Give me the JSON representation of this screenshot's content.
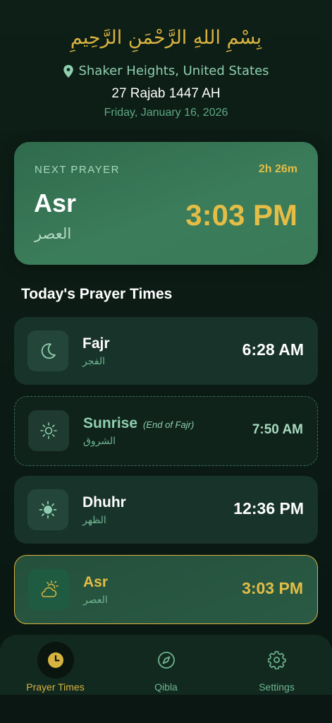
{
  "header": {
    "bismillah": "بِسْمِ اللهِ الرَّحْمَنِ الرَّحِيمِ",
    "location": "Shaker Heights, United States",
    "hijri_date": "27 Rajab 1447 AH",
    "gregorian_date": "Friday, January 16, 2026"
  },
  "next_prayer": {
    "label": "NEXT PRAYER",
    "countdown": "2h 26m",
    "name": "Asr",
    "arabic": "العصر",
    "time": "3:03 PM"
  },
  "section_title": "Today's Prayer Times",
  "prayers": [
    {
      "name": "Fajr",
      "arabic": "الفجر",
      "time": "6:28 AM",
      "icon": "moon-icon"
    },
    {
      "name": "Sunrise",
      "note": "(End of Fajr)",
      "arabic": "الشروق",
      "time": "7:50 AM",
      "icon": "sun-outline-icon"
    },
    {
      "name": "Dhuhr",
      "arabic": "الظهر",
      "time": "12:36 PM",
      "icon": "sun-icon"
    },
    {
      "name": "Asr",
      "arabic": "العصر",
      "time": "3:03 PM",
      "icon": "cloud-sun-icon"
    }
  ],
  "nav": {
    "items": [
      {
        "label": "Prayer Times",
        "icon": "clock-icon",
        "active": true
      },
      {
        "label": "Qibla",
        "icon": "compass-icon",
        "active": false
      },
      {
        "label": "Settings",
        "icon": "gear-icon",
        "active": false
      }
    ]
  },
  "colors": {
    "background": "#0b1a14",
    "accent_gold": "#d9b340",
    "accent_green": "#8fcfb0",
    "card_green": "#3b7c5a"
  }
}
